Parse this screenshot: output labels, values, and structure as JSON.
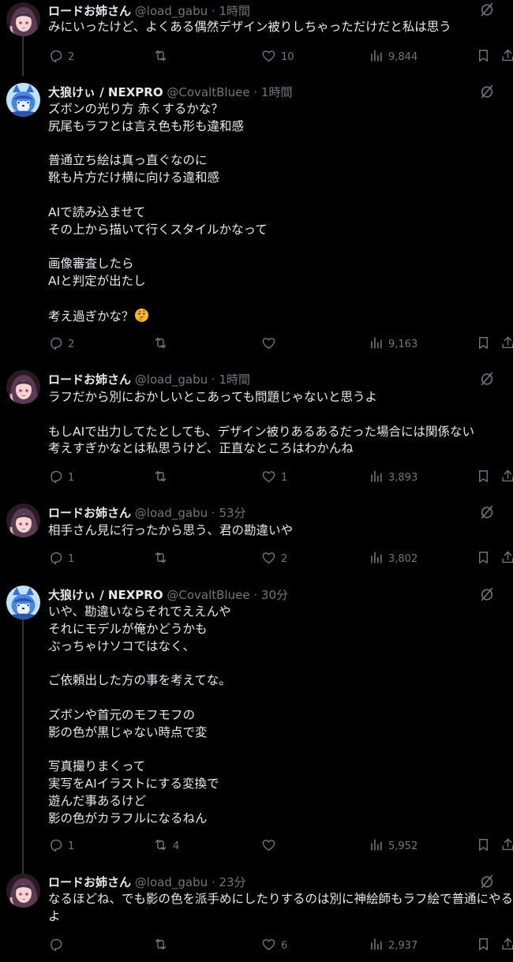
{
  "tweets": [
    {
      "avatar": "load",
      "name": "ロードお姉さん",
      "handle": "@load_gabu",
      "time": "1時間",
      "text": "みにいったけど、よくある偶然デザイン被りしちゃっただけだと私は思う",
      "replies": "2",
      "retweets": "",
      "likes": "10",
      "views": "9,844"
    },
    {
      "avatar": "covalt",
      "name": "大狼けぃ / NEXPRO",
      "handle": "@CovaltBluee",
      "time": "1時間",
      "text": "ズボンの光り方 赤くするかな？\n尻尾もラフとは言え色も形も違和感\n\n普通立ち絵は真っ直ぐなのに\n靴も片方だけ横に向ける違和感\n\nAIで読み込ませて\nその上から描いて行くスタイルかなって\n\n画像審査したら\nAIと判定が出たし\n\n考え過ぎかな？",
      "emoji": "thinking-face",
      "replies": "2",
      "retweets": "",
      "likes": "",
      "views": "9,163"
    },
    {
      "avatar": "load",
      "name": "ロードお姉さん",
      "handle": "@load_gabu",
      "time": "1時間",
      "text": "ラフだから別におかしいとこあっても問題じゃないと思うよ\n\nもしAIで出力してたとしても、デザイン被りあるあるだった場合には関係ない\n考えすぎかなとは私思うけど、正直なところはわかんね",
      "replies": "1",
      "retweets": "",
      "likes": "1",
      "views": "3,893"
    },
    {
      "avatar": "load",
      "name": "ロードお姉さん",
      "handle": "@load_gabu",
      "time": "53分",
      "text": "相手さん見に行ったから思う、君の勘違いや",
      "replies": "1",
      "retweets": "",
      "likes": "2",
      "views": "3,802"
    },
    {
      "avatar": "covalt",
      "name": "大狼けぃ / NEXPRO",
      "handle": "@CovaltBluee",
      "time": "30分",
      "text": "いや、勘違いならそれでええんや\nそれにモデルが俺かどうかも\nぶっちゃけソコではなく、\n\nご依頼出した方の事を考えてな。\n\nズボンや首元のモフモフの\n影の色が黒じゃない時点で変\n\n写真撮りまくって\n実写をAIイラストにする変換で\n遊んだ事あるけど\n影の色がカラフルになるねん",
      "replies": "1",
      "retweets": "4",
      "likes": "",
      "views": "5,952"
    },
    {
      "avatar": "load",
      "name": "ロードお姉さん",
      "handle": "@load_gabu",
      "time": "23分",
      "text": "なるほどね、でも影の色を派手めにしたりするのは別に神絵師もラフ絵で普通にやるよ",
      "replies": "",
      "retweets": "",
      "likes": "6",
      "views": "2,937"
    }
  ],
  "dot": "·",
  "icons": {
    "reply": "reply-icon",
    "retweet": "retweet-icon",
    "like": "heart-icon",
    "views": "bar-chart-icon",
    "bookmark": "bookmark-icon",
    "share": "share-icon",
    "grok": "grok-icon"
  },
  "colors": {
    "background": "#000000",
    "text": "#e7e9ea",
    "muted": "#71767b",
    "thread_line": "#333639"
  }
}
